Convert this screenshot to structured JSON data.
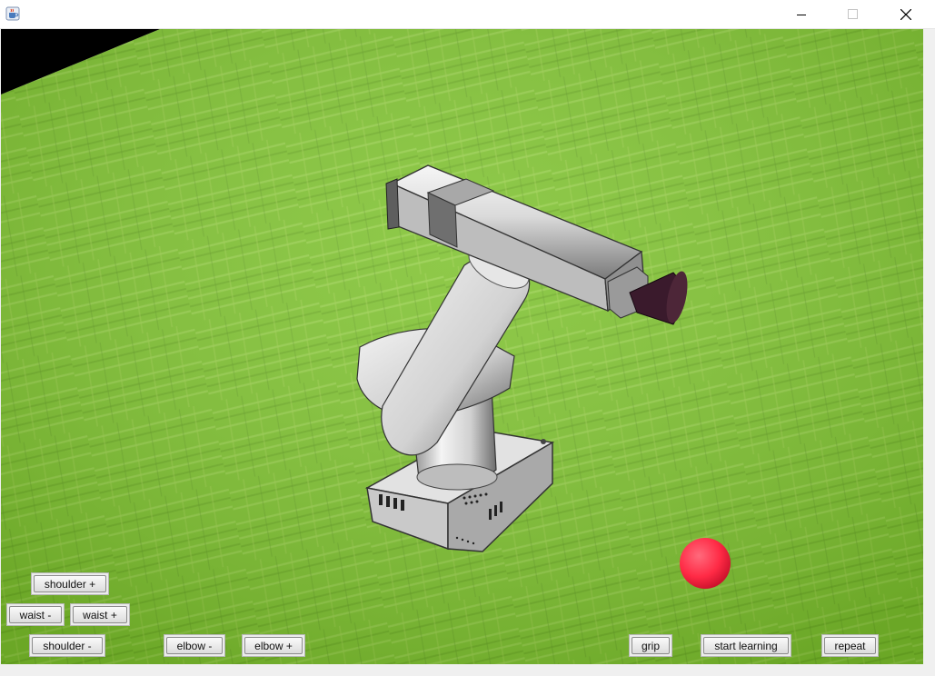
{
  "window": {
    "title": "",
    "icon": "java-cup-icon",
    "controls": [
      "minimize-icon",
      "maximize-icon",
      "close-icon"
    ]
  },
  "scene": {
    "objects": [
      "robot-arm",
      "target-ball"
    ],
    "colors": {
      "ground": "#7fc230",
      "ball": "#ff2a45",
      "robot": "#d4d4d4",
      "gripper": "#3a1a2c",
      "sky": "#000000"
    }
  },
  "controls": {
    "shoulder_plus": "shoulder +",
    "waist_minus": "waist -",
    "waist_plus": "waist +",
    "shoulder_minus": "shoulder -",
    "elbow_minus": "elbow -",
    "elbow_plus": "elbow +",
    "grip": "grip",
    "start_learning": "start learning",
    "repeat": "repeat"
  }
}
